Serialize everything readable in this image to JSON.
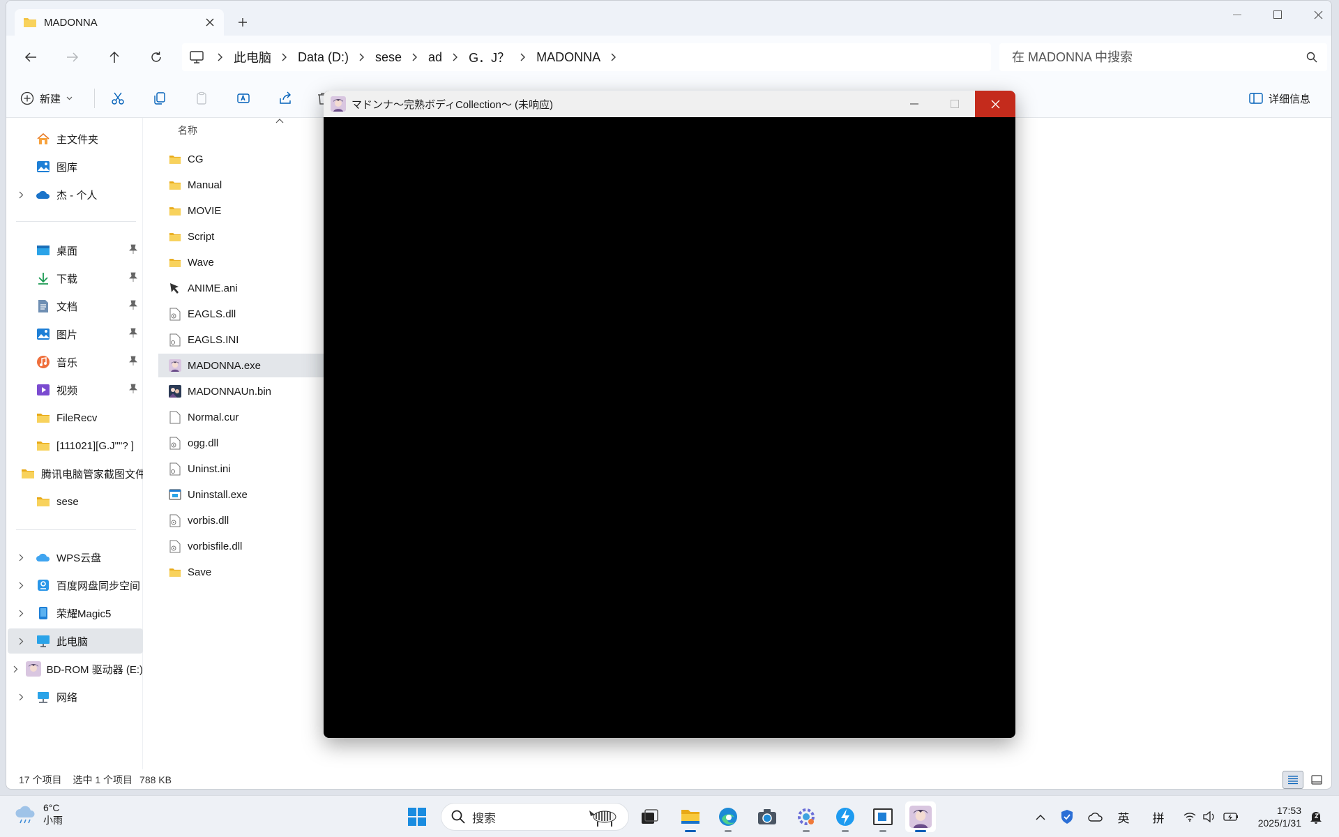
{
  "explorer": {
    "tab_title": "MADONNA",
    "breadcrumb": [
      "此电脑",
      "Data (D:)",
      "sese",
      "ad",
      "G．J？",
      "MADONNA"
    ],
    "search_placeholder": "在 MADONNA 中搜索",
    "toolbar": {
      "new_label": "新建",
      "details_label": "详细信息"
    },
    "sidebar": {
      "top": [
        {
          "label": "主文件夹",
          "icon": "home-icon"
        },
        {
          "label": "图库",
          "icon": "gallery-icon"
        },
        {
          "label": "杰 - 个人",
          "icon": "onedrive-icon"
        }
      ],
      "pinned": [
        {
          "label": "桌面",
          "icon": "desktop-icon"
        },
        {
          "label": "下载",
          "icon": "download-icon"
        },
        {
          "label": "文档",
          "icon": "documents-icon"
        },
        {
          "label": "图片",
          "icon": "pictures-icon"
        },
        {
          "label": "音乐",
          "icon": "music-icon"
        },
        {
          "label": "视频",
          "icon": "videos-icon"
        },
        {
          "label": "FileRecv",
          "icon": "folder-icon"
        },
        {
          "label": "[111021][G.J\"\"? ]",
          "icon": "folder-icon"
        },
        {
          "label": "腾讯电脑管家截图文件",
          "icon": "folder-icon"
        },
        {
          "label": "sese",
          "icon": "folder-icon"
        }
      ],
      "drives": [
        {
          "label": "WPS云盘",
          "icon": "cloud-icon"
        },
        {
          "label": "百度网盘同步空间",
          "icon": "baidu-icon"
        },
        {
          "label": "荣耀Magic5",
          "icon": "phone-icon"
        },
        {
          "label": "此电脑",
          "icon": "pc-icon"
        },
        {
          "label": "BD-ROM 驱动器 (E:)",
          "icon": "disc-icon"
        },
        {
          "label": "网络",
          "icon": "network-icon"
        }
      ]
    },
    "column_name": "名称",
    "files": [
      {
        "name": "CG",
        "type": "folder"
      },
      {
        "name": "Manual",
        "type": "folder"
      },
      {
        "name": "MOVIE",
        "type": "folder"
      },
      {
        "name": "Script",
        "type": "folder"
      },
      {
        "name": "Wave",
        "type": "folder"
      },
      {
        "name": "ANIME.ani",
        "type": "cursor"
      },
      {
        "name": "EAGLS.dll",
        "type": "dll"
      },
      {
        "name": "EAGLS.INI",
        "type": "ini"
      },
      {
        "name": "MADONNA.exe",
        "type": "app"
      },
      {
        "name": "MADONNAUn.bin",
        "type": "bin"
      },
      {
        "name": "Normal.cur",
        "type": "file"
      },
      {
        "name": "ogg.dll",
        "type": "dll"
      },
      {
        "name": "Uninst.ini",
        "type": "ini"
      },
      {
        "name": "Uninstall.exe",
        "type": "exe"
      },
      {
        "name": "vorbis.dll",
        "type": "dll"
      },
      {
        "name": "vorbisfile.dll",
        "type": "dll"
      },
      {
        "name": "Save",
        "type": "folder"
      }
    ],
    "selected_file": "MADONNA.exe",
    "status": {
      "count": "17 个项目",
      "selected": "选中 1 个项目",
      "size": "788 KB"
    }
  },
  "game_window": {
    "title": "マドンナ～完熟ボディCollection～ (未响应)"
  },
  "taskbar": {
    "weather_temp": "6°C",
    "weather_desc": "小雨",
    "search_label": "搜索",
    "ime_lang": "英",
    "ime_mode": "拼",
    "time": "17:53",
    "date": "2025/1/31"
  },
  "colors": {
    "accent": "#005fb8",
    "close_red": "#c42b1c",
    "folder": "#f3c343",
    "selection": "#e3e6ea"
  }
}
